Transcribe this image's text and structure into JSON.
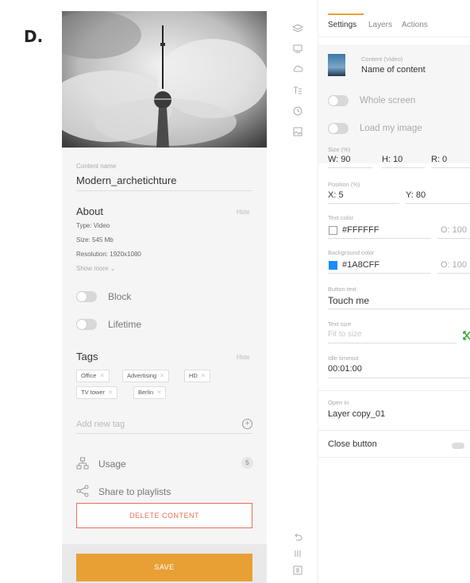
{
  "figure_letter": "D.",
  "left": {
    "content_name_label": "Content name",
    "content_name_value": "Modern_archetichture",
    "about_title": "About",
    "hide_label": "Hide",
    "info": [
      "Type: Video",
      "Size: 545 Mb",
      "Resolution: 1920x1080"
    ],
    "show_more": "Show more ⌄",
    "toggles": [
      {
        "label": "Block",
        "on": false
      },
      {
        "label": "Lifetime",
        "on": false
      }
    ],
    "tags_title": "Tags",
    "tags": [
      "Office",
      "Advertising",
      "HD",
      "TV tower",
      "Berlin"
    ],
    "add_tag_placeholder": "Add new tag",
    "usage_label": "Usage",
    "usage_count": "5",
    "share_label": "Share to playlists",
    "delete_button": "DELETE CONTENT",
    "save_button": "SAVE"
  },
  "rail_icons": [
    "layers-icon",
    "screen-icon",
    "cloud-icon",
    "text-icon",
    "clock-icon",
    "image-icon",
    "undo-icon",
    "grid-icon",
    "settings-box-icon"
  ],
  "right": {
    "tabs": [
      "Settings",
      "Layers",
      "Actions"
    ],
    "content_type": "Content (Video)",
    "content_name": "Name of content",
    "whole_screen": "Whole screen",
    "load_image": "Load my image",
    "size_label": "Size (%)",
    "size_w": "W: 90",
    "size_h": "H: 10",
    "size_r": "R: 0",
    "position_label": "Position (%)",
    "pos_x": "X: 5",
    "pos_y": "Y: 80",
    "text_color_label": "Text color",
    "text_color_value": "#FFFFFF",
    "text_opacity": "O: 100",
    "bg_color_label": "Background color",
    "bg_color_value": "#1A8CFF",
    "bg_opacity": "O: 100",
    "button_text_label": "Button text",
    "button_text_value": "Touch me",
    "text_size_label": "Text size",
    "text_size_value": "Fit to size",
    "idle_label": "Idle timeout",
    "idle_value": "00:01:00",
    "open_in_label": "Open in",
    "open_in_value": "Layer copy_01",
    "close_button_label": "Close button"
  },
  "colors": {
    "accent": "#e8a035",
    "danger": "#e86f55",
    "blue": "#1a8cff"
  }
}
